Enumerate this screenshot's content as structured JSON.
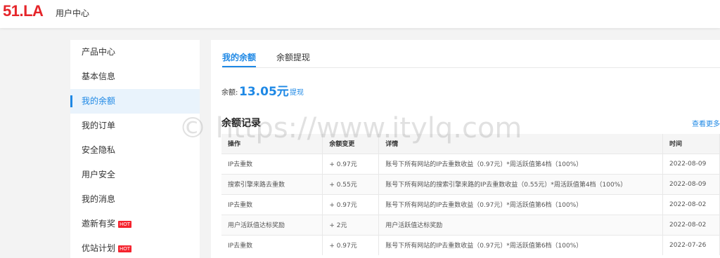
{
  "header": {
    "logo": "51.LA",
    "subtitle": "用户中心"
  },
  "sidebar": {
    "items": [
      {
        "label": "产品中心"
      },
      {
        "label": "基本信息"
      },
      {
        "label": "我的余额"
      },
      {
        "label": "我的订单"
      },
      {
        "label": "安全隐私"
      },
      {
        "label": "用户安全"
      },
      {
        "label": "我的消息"
      },
      {
        "label": "邀新有奖",
        "badge": "HOT"
      },
      {
        "label": "优站计划",
        "badge": "HOT"
      }
    ],
    "active_index": 2
  },
  "tabs": [
    {
      "label": "我的余额"
    },
    {
      "label": "余额提现"
    }
  ],
  "balance": {
    "label": "余额:",
    "amount": "13.05元",
    "withdraw_link": "提现"
  },
  "records": {
    "title": "余额记录",
    "view_more": "查看更多",
    "columns": [
      "操作",
      "余额变更",
      "详情",
      "时间"
    ],
    "rows": [
      [
        "IP去重数",
        "+ 0.97元",
        "账号下所有网站的IP去重数收益（0.97元）*周活跃值第4档（100%）",
        "2022-08-09"
      ],
      [
        "搜索引擎来路去重数",
        "+ 0.55元",
        "账号下所有网站的搜索引擎来路的IP去重数收益（0.55元）*周活跃值第4档（100%）",
        "2022-08-09"
      ],
      [
        "IP去重数",
        "+ 0.97元",
        "账号下所有网站的IP去重数收益（0.97元）*周活跃值第6档（100%）",
        "2022-08-02"
      ],
      [
        "用户活跃值达标奖励",
        "+ 2元",
        "用户活跃值达标奖励",
        "2022-08-02"
      ],
      [
        "IP去重数",
        "+ 0.97元",
        "账号下所有网站的IP去重数收益（0.97元）*周活跃值第6档（100%）",
        "2022-07-26"
      ]
    ]
  },
  "watermark": "© https://www.itylq.com"
}
